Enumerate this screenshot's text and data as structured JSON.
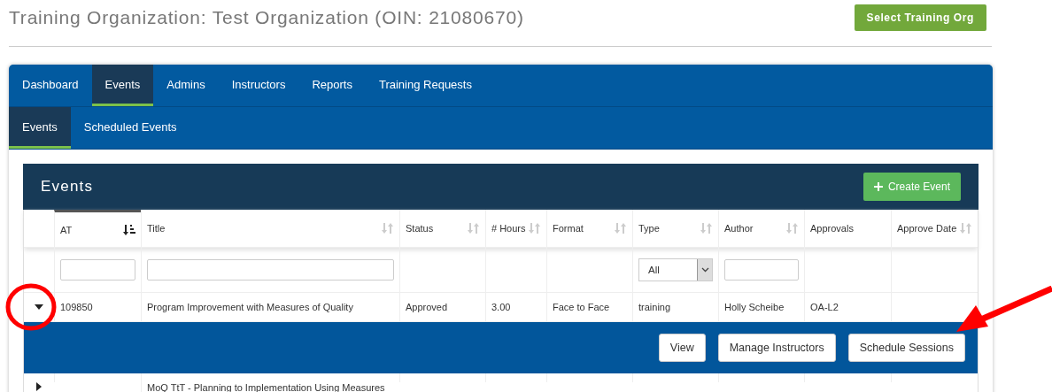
{
  "header": {
    "title": "Training Organization: Test Organization (OIN: 21080670)",
    "button": "Select Training Org"
  },
  "tabs": [
    {
      "label": "Dashboard",
      "selected": false
    },
    {
      "label": "Events",
      "selected": true
    },
    {
      "label": "Admins",
      "selected": false
    },
    {
      "label": "Instructors",
      "selected": false
    },
    {
      "label": "Reports",
      "selected": false
    },
    {
      "label": "Training Requests",
      "selected": false
    }
  ],
  "subtabs": [
    {
      "label": "Events",
      "selected": true
    },
    {
      "label": "Scheduled Events",
      "selected": false
    }
  ],
  "panel": {
    "title": "Events",
    "create_button": "Create Event"
  },
  "table": {
    "columns": [
      {
        "label": "AT",
        "sortable": true,
        "sorted": true,
        "kind": "text"
      },
      {
        "label": "Title",
        "sortable": true,
        "sorted": false,
        "kind": "text"
      },
      {
        "label": "Status",
        "sortable": true,
        "sorted": false,
        "kind": "plain"
      },
      {
        "label": "# Hours",
        "sortable": true,
        "sorted": false,
        "kind": "plain"
      },
      {
        "label": "Format",
        "sortable": true,
        "sorted": false,
        "kind": "plain"
      },
      {
        "label": "Type",
        "sortable": true,
        "sorted": false,
        "kind": "select",
        "value": "All"
      },
      {
        "label": "Author",
        "sortable": true,
        "sorted": false,
        "kind": "text"
      },
      {
        "label": "Approvals",
        "sortable": false,
        "sorted": false,
        "kind": "plain"
      },
      {
        "label": "Approve Date",
        "sortable": true,
        "sorted": false,
        "kind": "plain"
      }
    ],
    "rows": [
      {
        "expanded": true,
        "cells": [
          "109850",
          "Program Improvement with Measures of Quality",
          "Approved",
          "3.00",
          "Face to Face",
          "training",
          "Holly Scheibe",
          "OA-L2",
          ""
        ],
        "actions": [
          "View",
          "Manage Instructors",
          "Schedule Sessions"
        ]
      },
      {
        "expanded": false,
        "cells": [
          "",
          "MoQ TtT - Planning to Implementation Using Measures",
          "",
          "",
          "",
          "",
          "",
          "",
          ""
        ]
      }
    ]
  }
}
